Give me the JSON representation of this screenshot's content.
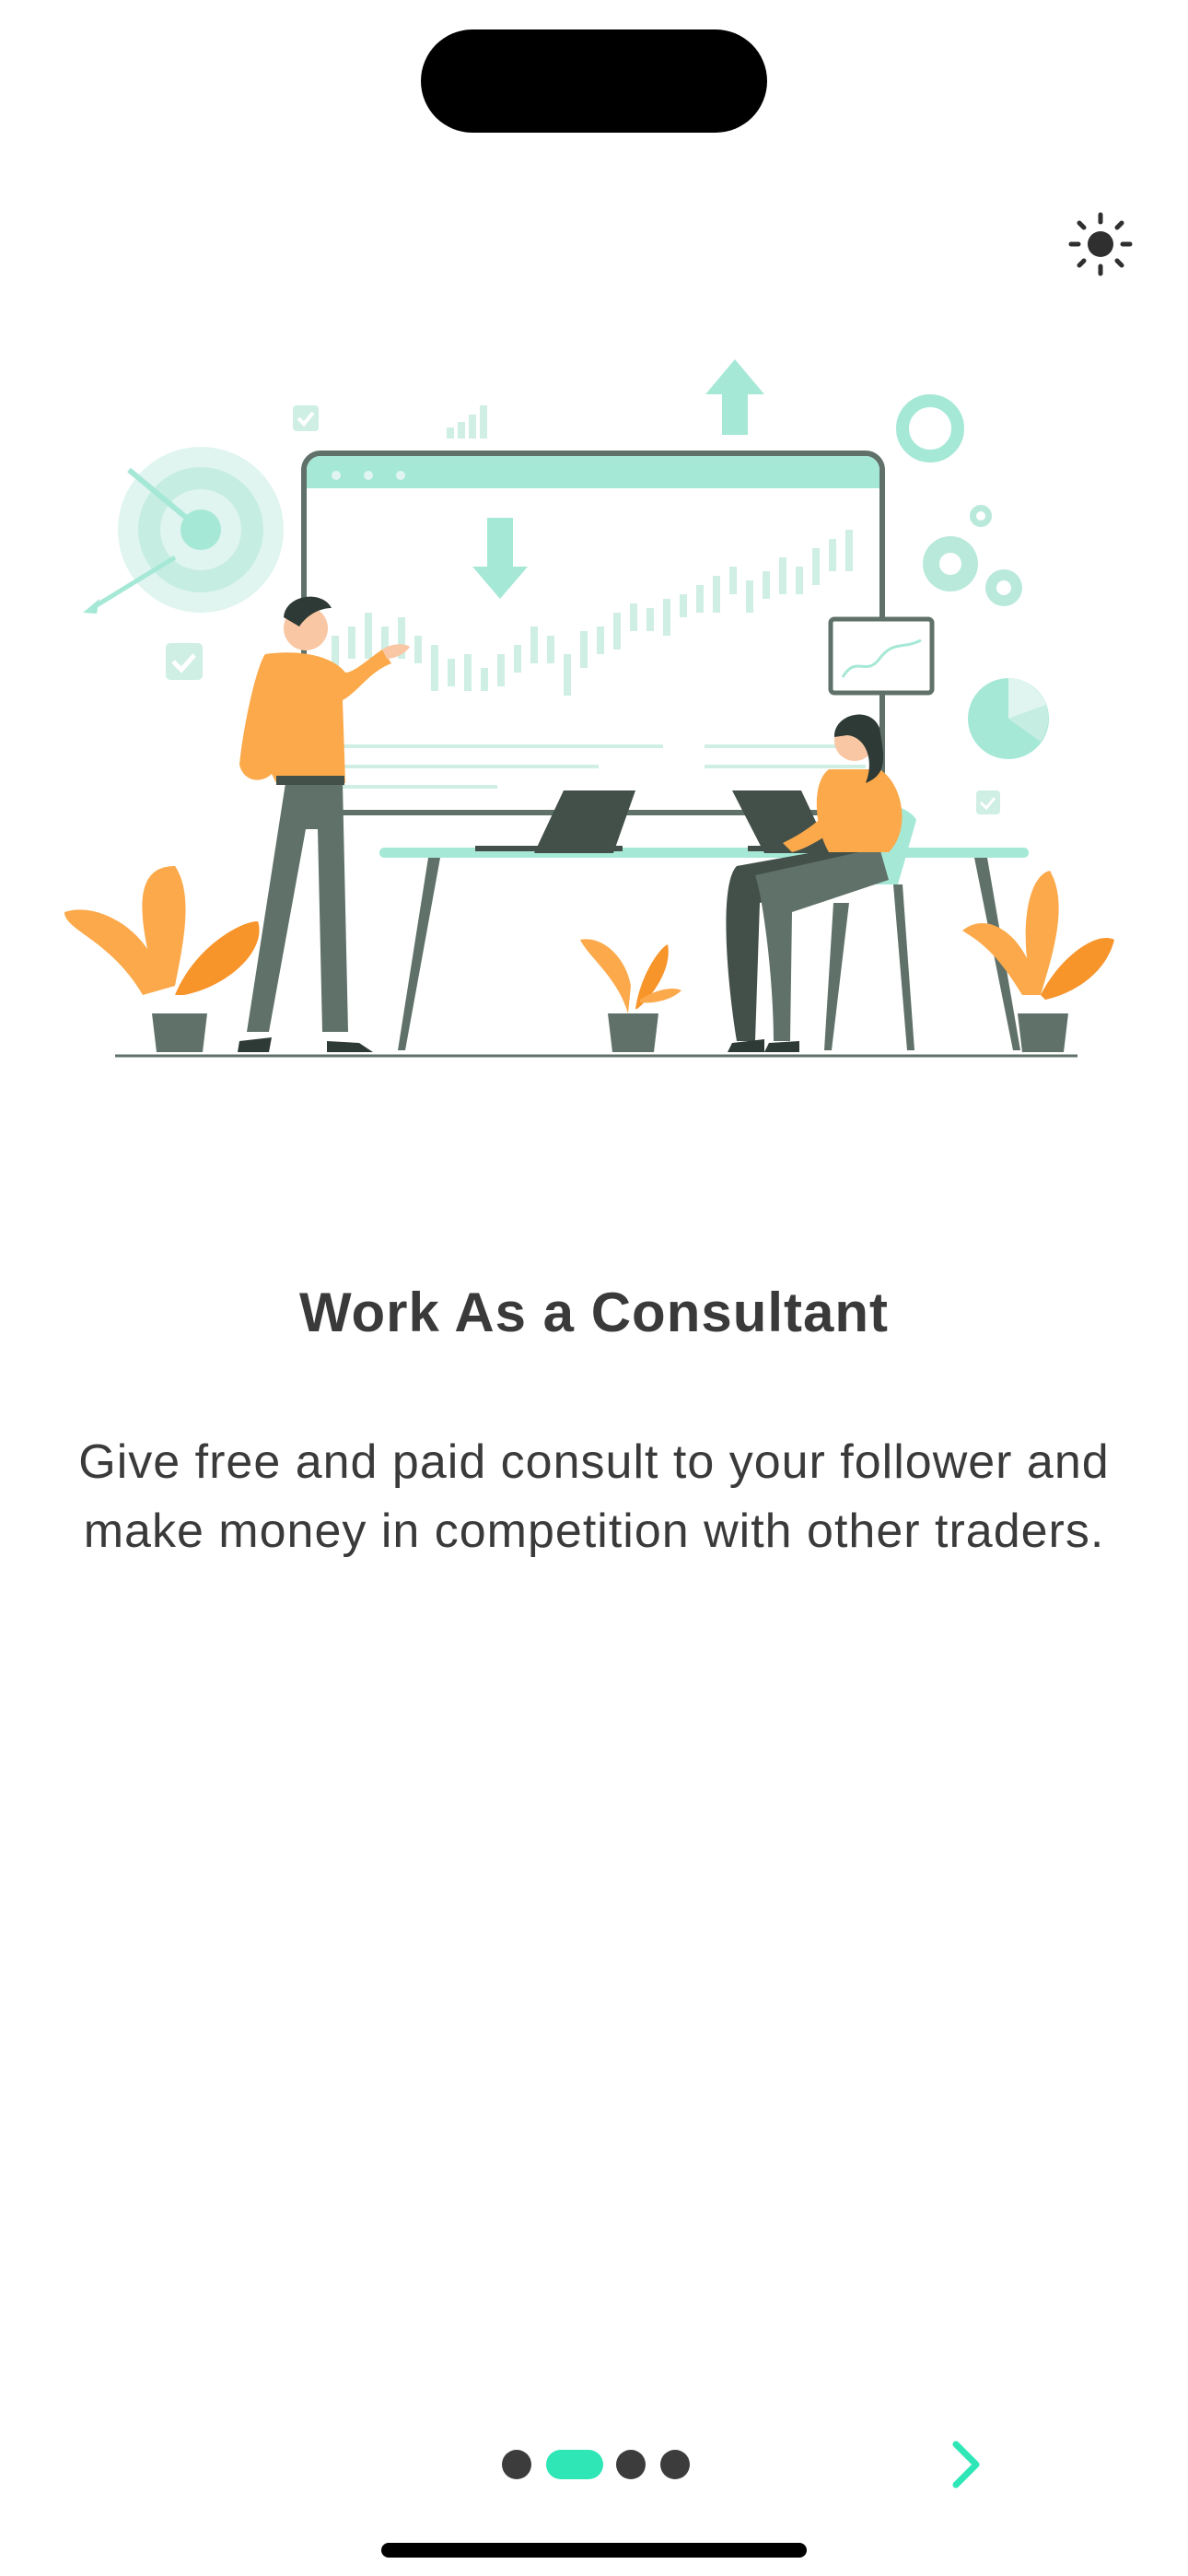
{
  "onboarding": {
    "title": "Work As a Consultant",
    "description": "Give free and paid consult to your follower and make money in competition with other traders.",
    "page_count": 4,
    "active_page": 2
  },
  "icons": {
    "theme_toggle": "sun-icon",
    "next": "chevron-right-icon",
    "illustration": "consultants-trading-illustration"
  },
  "colors": {
    "accent": "#2ee6b6",
    "text": "#3a3a3a",
    "mint": "#a6e8d6",
    "orange": "#fba94a",
    "dark_gray": "#5f7169"
  }
}
